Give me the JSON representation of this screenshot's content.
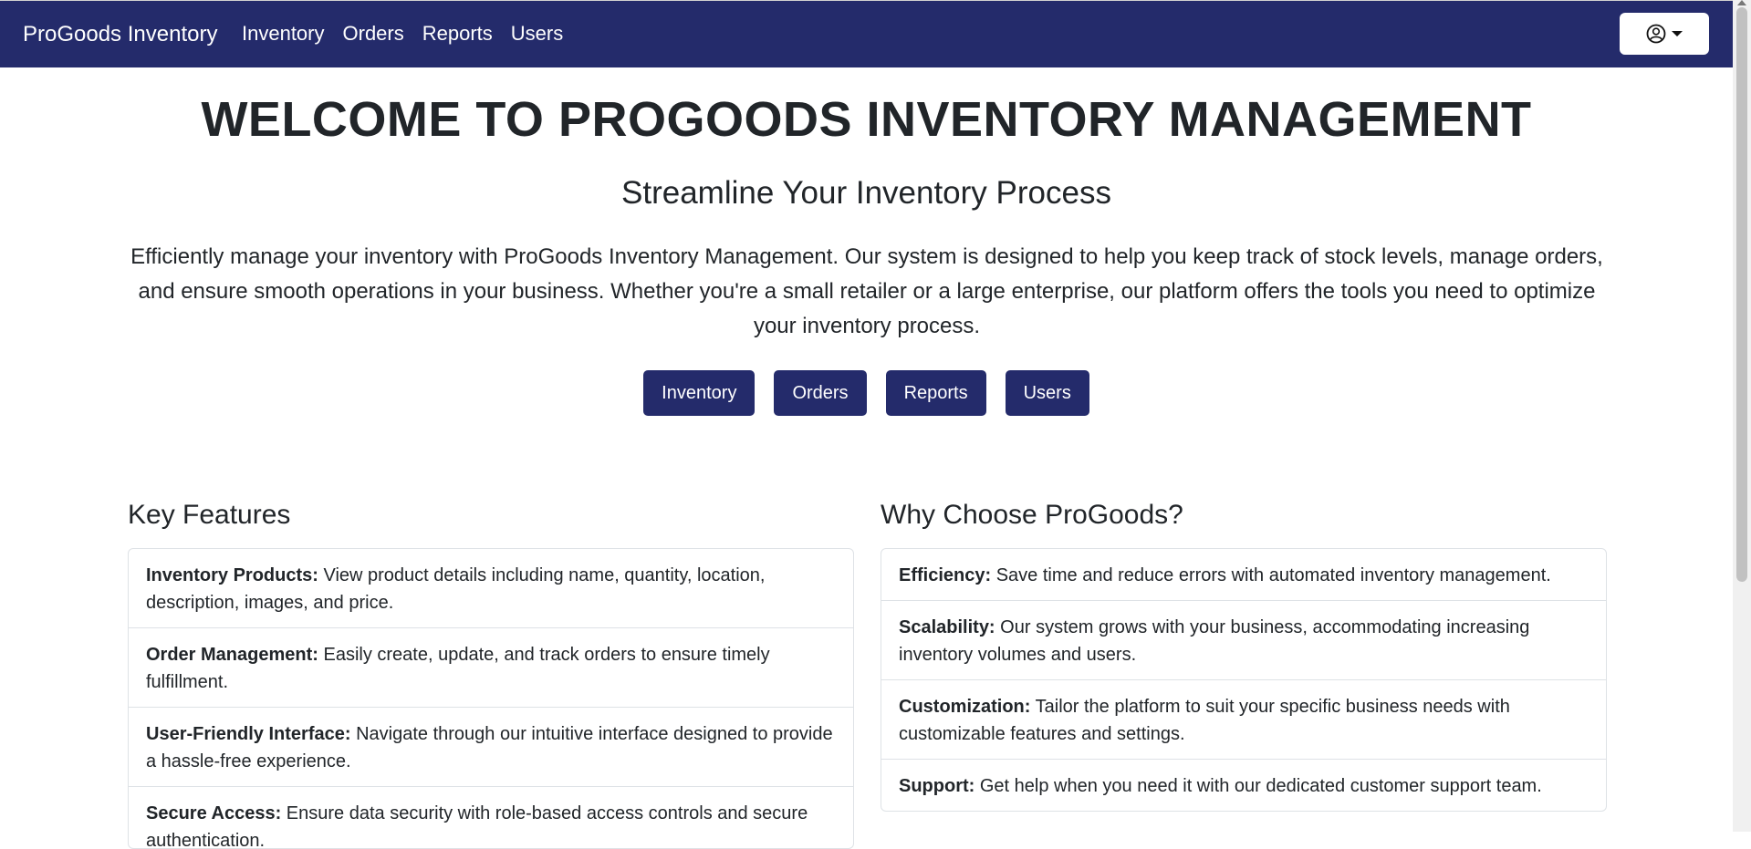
{
  "navbar": {
    "brand": "ProGoods Inventory",
    "links": [
      "Inventory",
      "Orders",
      "Reports",
      "Users"
    ],
    "user_icon": "user-circle-icon"
  },
  "hero": {
    "title": "WELCOME TO PROGOODS INVENTORY MANAGEMENT",
    "subtitle": "Streamline Your Inventory Process",
    "description": "Efficiently manage your inventory with ProGoods Inventory Management. Our system is designed to help you keep track of stock levels, manage orders, and ensure smooth operations in your business. Whether you're a small retailer or a large enterprise, our platform offers the tools you need to optimize your inventory process.",
    "buttons": [
      "Inventory",
      "Orders",
      "Reports",
      "Users"
    ]
  },
  "key_features": {
    "title": "Key Features",
    "items": [
      {
        "label": "Inventory Products:",
        "text": " View product details including name, quantity, location, description, images, and price."
      },
      {
        "label": "Order Management:",
        "text": " Easily create, update, and track orders to ensure timely fulfillment."
      },
      {
        "label": "User-Friendly Interface:",
        "text": " Navigate through our intuitive interface designed to provide a hassle-free experience."
      },
      {
        "label": "Secure Access:",
        "text": " Ensure data security with role-based access controls and secure authentication."
      }
    ]
  },
  "why_choose": {
    "title": "Why Choose ProGoods?",
    "items": [
      {
        "label": "Efficiency:",
        "text": " Save time and reduce errors with automated inventory management."
      },
      {
        "label": "Scalability:",
        "text": " Our system grows with your business, accommodating increasing inventory volumes and users."
      },
      {
        "label": "Customization:",
        "text": " Tailor the platform to suit your specific business needs with customizable features and settings."
      },
      {
        "label": "Support:",
        "text": " Get help when you need it with our dedicated customer support team."
      }
    ]
  },
  "colors": {
    "navbar_bg": "#242b6b",
    "button_bg": "#242b6b"
  }
}
